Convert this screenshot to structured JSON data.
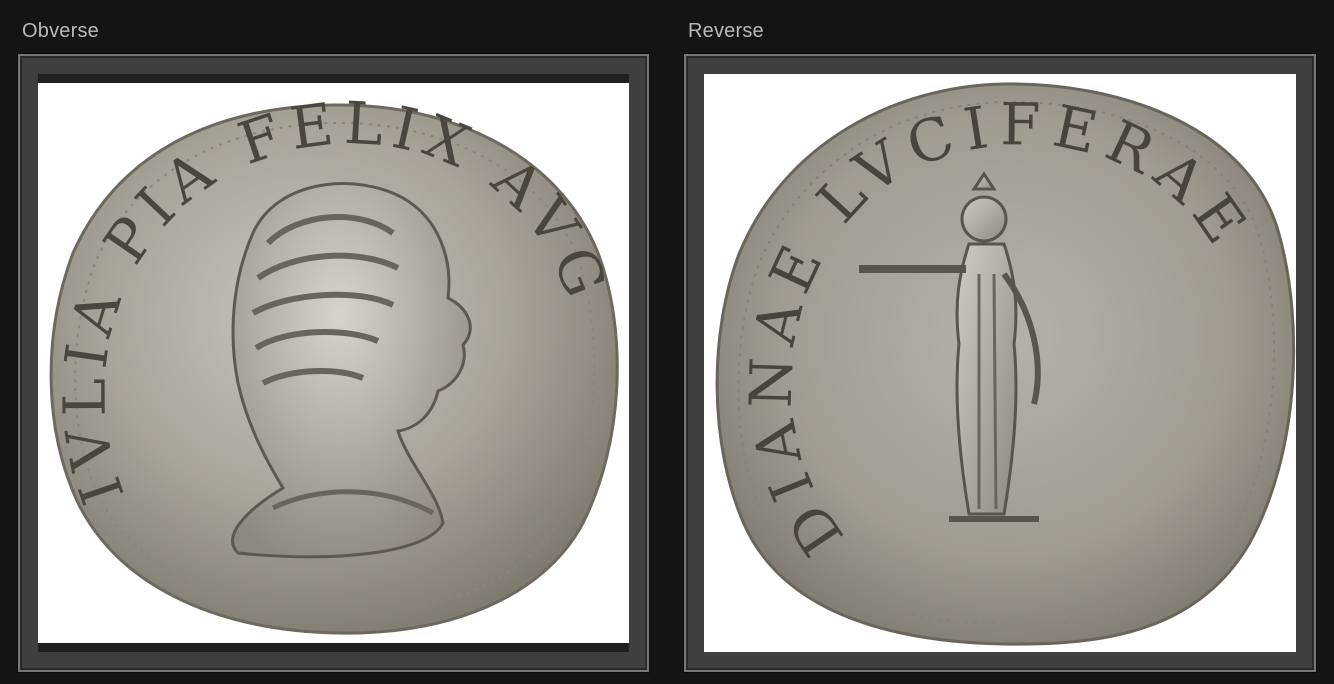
{
  "panels": {
    "obverse": {
      "label": "Obverse",
      "legend": "IVLIA PIA FELIX AVG"
    },
    "reverse": {
      "label": "Reverse",
      "legend": "DIANAE LVCIFERAE"
    }
  },
  "colors": {
    "page_background": "#141414",
    "frame_border": "#777777",
    "label_text": "#b9b9b9",
    "coin_silver": "#a8a49a"
  }
}
